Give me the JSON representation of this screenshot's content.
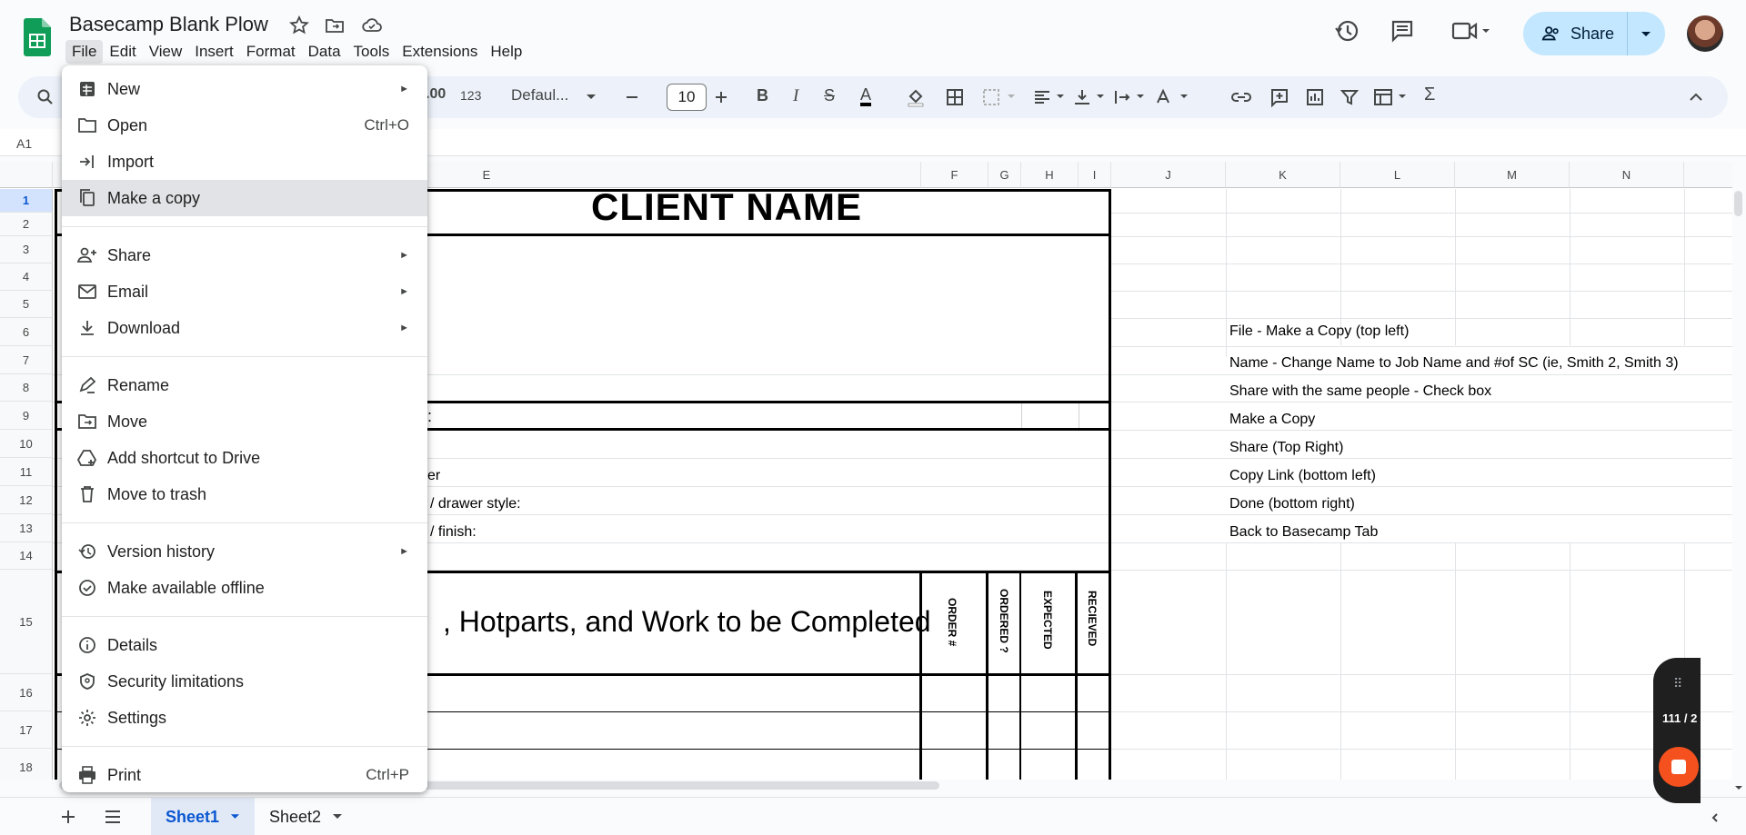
{
  "app": {
    "doc_title": "Basecamp Blank Plow",
    "menu": [
      "File",
      "Edit",
      "View",
      "Insert",
      "Format",
      "Data",
      "Tools",
      "Extensions",
      "Help"
    ],
    "share_label": "Share"
  },
  "toolbar": {
    "format_number": "123",
    "format_dec": ".00",
    "font_name": "Defaul...",
    "font_size": "10"
  },
  "formula_bar": {
    "cell_ref": "A1"
  },
  "columns": [
    "E",
    "F",
    "G",
    "H",
    "I",
    "J",
    "K",
    "L",
    "M",
    "N"
  ],
  "rows": [
    "1",
    "2",
    "3",
    "4",
    "5",
    "6",
    "7",
    "8",
    "9",
    "10",
    "11",
    "12",
    "13",
    "14",
    "15",
    "16",
    "17",
    "18"
  ],
  "sheet": {
    "client_name": "CLIENT NAME",
    "row9_text": ":",
    "row11_text": "er",
    "row12_text": "/ drawer style:",
    "row13_text": "/ finish:",
    "row15_text": ", Hotparts, and Work to be Completed",
    "vertical_headers": [
      "ORDER #",
      "ORDERED ?",
      "EXPECTED",
      "RECIEVED"
    ],
    "instructions": [
      "File - Make a Copy (top left)",
      "Name - Change Name to Job Name and #of SC (ie, Smith 2, Smith 3)",
      "Share with the same people - Check box",
      "Make a Copy",
      "Share (Top Right)",
      "Copy Link (bottom left)",
      "Done (bottom right)",
      "Back to Basecamp Tab"
    ]
  },
  "tabs": [
    "Sheet1",
    "Sheet2"
  ],
  "recorder": {
    "count": "111 / 2"
  },
  "file_menu": {
    "new": "New",
    "open": "Open",
    "open_shortcut": "Ctrl+O",
    "import": "Import",
    "make_copy": "Make a copy",
    "share": "Share",
    "email": "Email",
    "download": "Download",
    "rename": "Rename",
    "move": "Move",
    "add_shortcut": "Add shortcut to Drive",
    "trash": "Move to trash",
    "version_history": "Version history",
    "offline": "Make available offline",
    "details": "Details",
    "security": "Security limitations",
    "settings": "Settings",
    "print": "Print",
    "print_shortcut": "Ctrl+P"
  },
  "colors": {
    "accent": "#0b57d0",
    "share_bg": "#c2e7ff",
    "sheets_green": "#0f9d58"
  }
}
